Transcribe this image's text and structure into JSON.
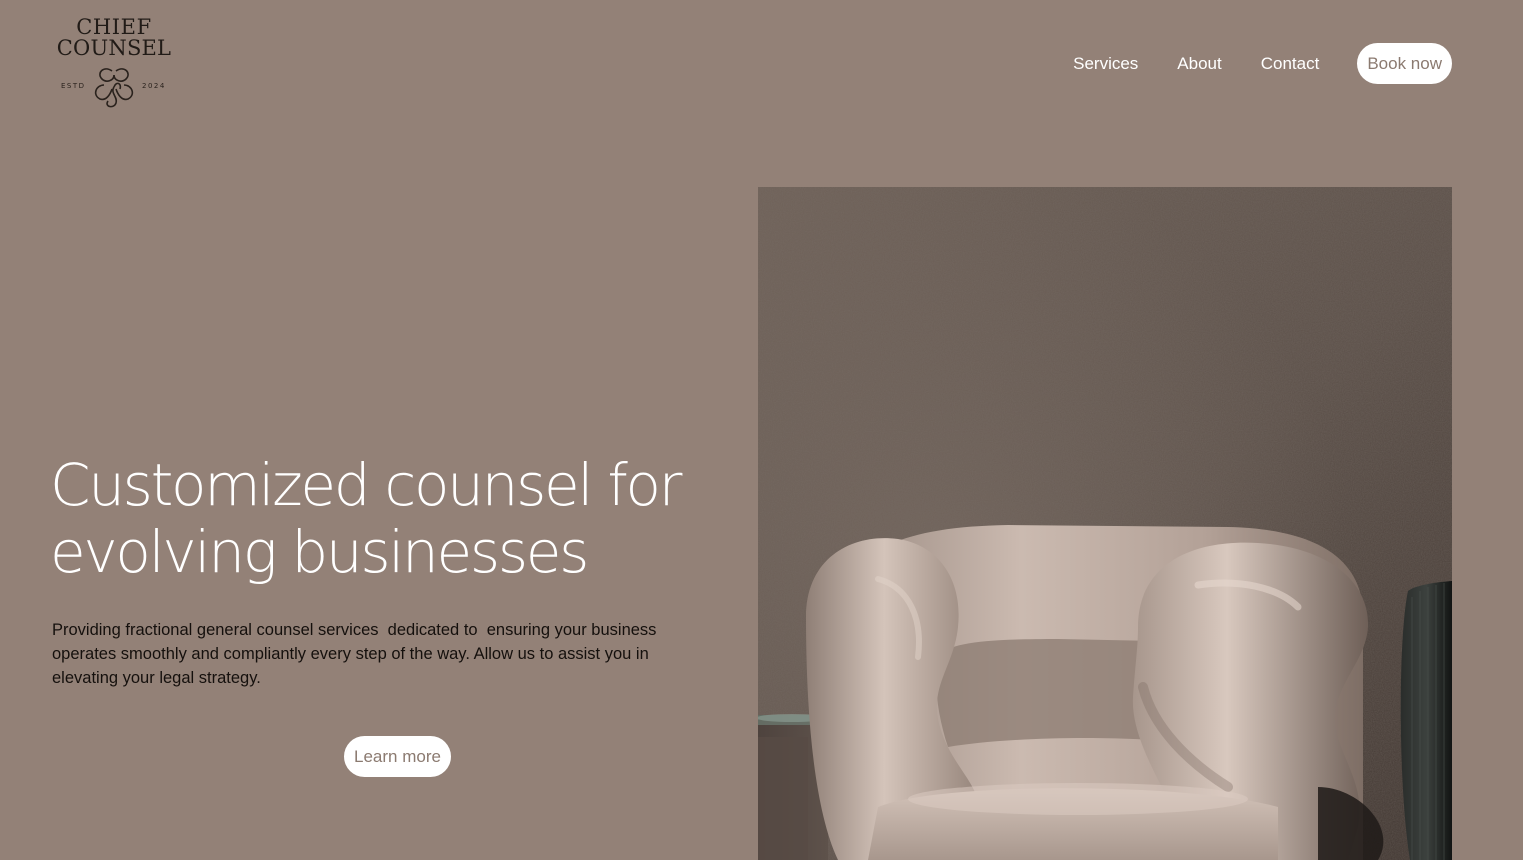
{
  "brand": {
    "logo_line1": "CHIEF",
    "logo_line2": "COUNSEL",
    "logo_estd": "ESTD",
    "logo_year": "2024",
    "logo_icon": "knot-icon"
  },
  "nav": {
    "items": [
      {
        "label": "Services"
      },
      {
        "label": "About"
      },
      {
        "label": "Contact"
      }
    ],
    "cta_label": "Book now"
  },
  "hero": {
    "title_line1": "Customized counsel for",
    "title_line2": "evolving businesses",
    "subtitle": "Providing fractional general counsel services  dedicated to  ensuring your business operates smoothly and compliantly every step of the way. Allow us to assist you in elevating your legal strategy.",
    "cta_label": "Learn more",
    "image_subject": "sculptural armchair against textured wall"
  },
  "colors": {
    "background": "#938177",
    "text_light": "#ffffff",
    "text_dark": "#15100d",
    "button_bg": "#ffffff",
    "button_text": "#8b7a70"
  }
}
